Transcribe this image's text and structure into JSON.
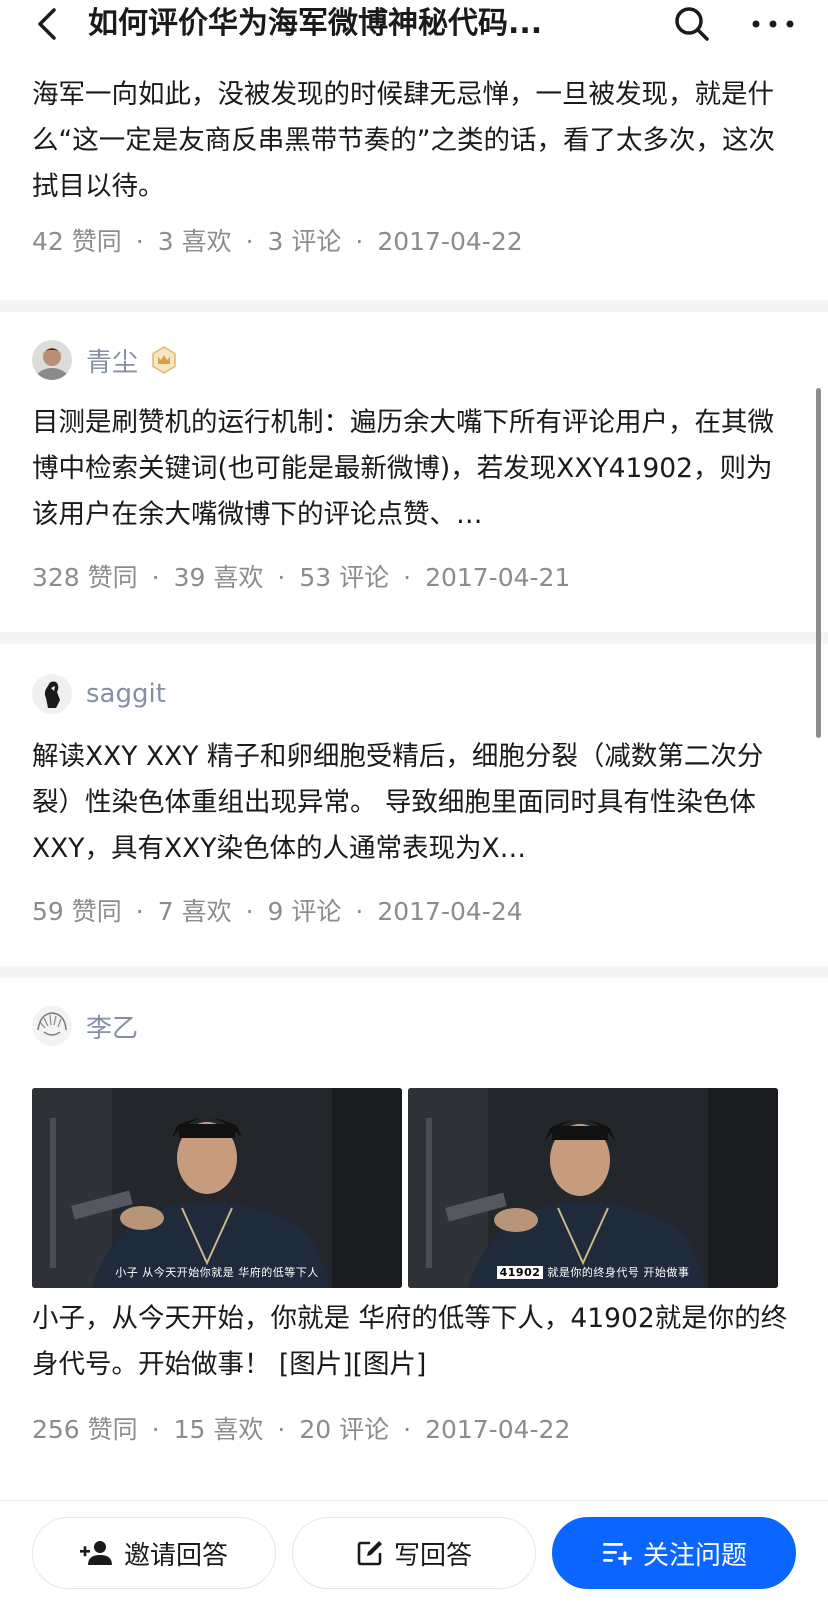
{
  "header": {
    "title": "如何评价华为海军微博神秘代码...",
    "back_icon": "chevron-left-icon",
    "search_icon": "search-icon",
    "more_icon": "more-horizontal-icon"
  },
  "answers": [
    {
      "content": "海军一向如此，没被发现的时候肆无忌惮，一旦被发现，就是什么“这一定是友商反串黑带节奏的”之类的话，看了太多次，这次拭目以待。",
      "meta": {
        "likes": "42 赞同",
        "favs": "3 喜欢",
        "comments": "3 评论",
        "date": "2017-04-22"
      }
    },
    {
      "author": "青尘",
      "content": "目测是刷赞机的运行机制：遍历余大嘴下所有评论用户，在其微博中检索关键词(也可能是最新微博)，若发现XXY41902，则为该用户在余大嘴微博下的评论点赞、…",
      "meta": {
        "likes": "328 赞同",
        "favs": "39 喜欢",
        "comments": "53 评论",
        "date": "2017-04-21"
      }
    },
    {
      "author": "saggit",
      "content": "解读XXY XXY 精子和卵细胞受精后，细胞分裂（减数第二次分裂）性染色体重组出现异常。 导致细胞里面同时具有性染色体XXY，具有XXY染色体的人通常表现为X…",
      "meta": {
        "likes": "59 赞同",
        "favs": "7 喜欢",
        "comments": "9 评论",
        "date": "2017-04-24"
      }
    },
    {
      "author": "李乙",
      "images": [
        {
          "caption": "小子 从今天开始你就是 华府的低等下人"
        },
        {
          "caption_code": "41902",
          "caption": "就是你的终身代号 开始做事"
        }
      ],
      "content": "小子，从今天开始，你就是 华府的低等下人，41902就是你的终身代号。开始做事！ [图片][图片]",
      "meta": {
        "likes": "256 赞同",
        "favs": "15 喜欢",
        "comments": "20 评论",
        "date": "2017-04-22"
      }
    }
  ],
  "bottom_bar": {
    "invite": {
      "label": "邀请回答",
      "icon": "add-user-icon"
    },
    "write": {
      "label": "写回答",
      "icon": "edit-icon"
    },
    "follow": {
      "label": "关注问题",
      "icon": "follow-list-icon"
    }
  },
  "colors": {
    "accent": "#0a66ff",
    "meta_text": "#8c8c8c",
    "author_text": "#8590a6",
    "separator": "#f4f5f7"
  }
}
